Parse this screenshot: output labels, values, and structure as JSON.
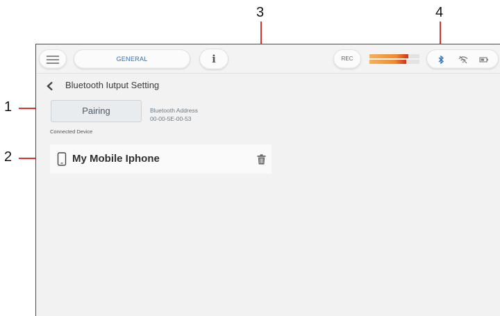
{
  "callouts": [
    "1",
    "2",
    "3",
    "4"
  ],
  "topbar": {
    "general_label": "GENERAL",
    "info_label": "i",
    "rec_label": "REC",
    "level_meter": [
      0.78,
      0.73
    ],
    "status_icons": [
      "bluetooth-icon",
      "wifi-off-icon",
      "battery-icon"
    ]
  },
  "page": {
    "title": "Bluetooth Iutput Setting"
  },
  "pairing": {
    "button_label": "Pairing",
    "address_label": "Bluetooth Address",
    "address_value": "00-00-5E-00-53"
  },
  "connected": {
    "section_label": "Connected Device",
    "devices": [
      {
        "name": "My Mobile Iphone",
        "icon": "smartphone-icon"
      }
    ]
  },
  "colors": {
    "accent": "#2a6fb3",
    "callout_line": "#d9312b",
    "meter_high": "#e04a1f"
  }
}
